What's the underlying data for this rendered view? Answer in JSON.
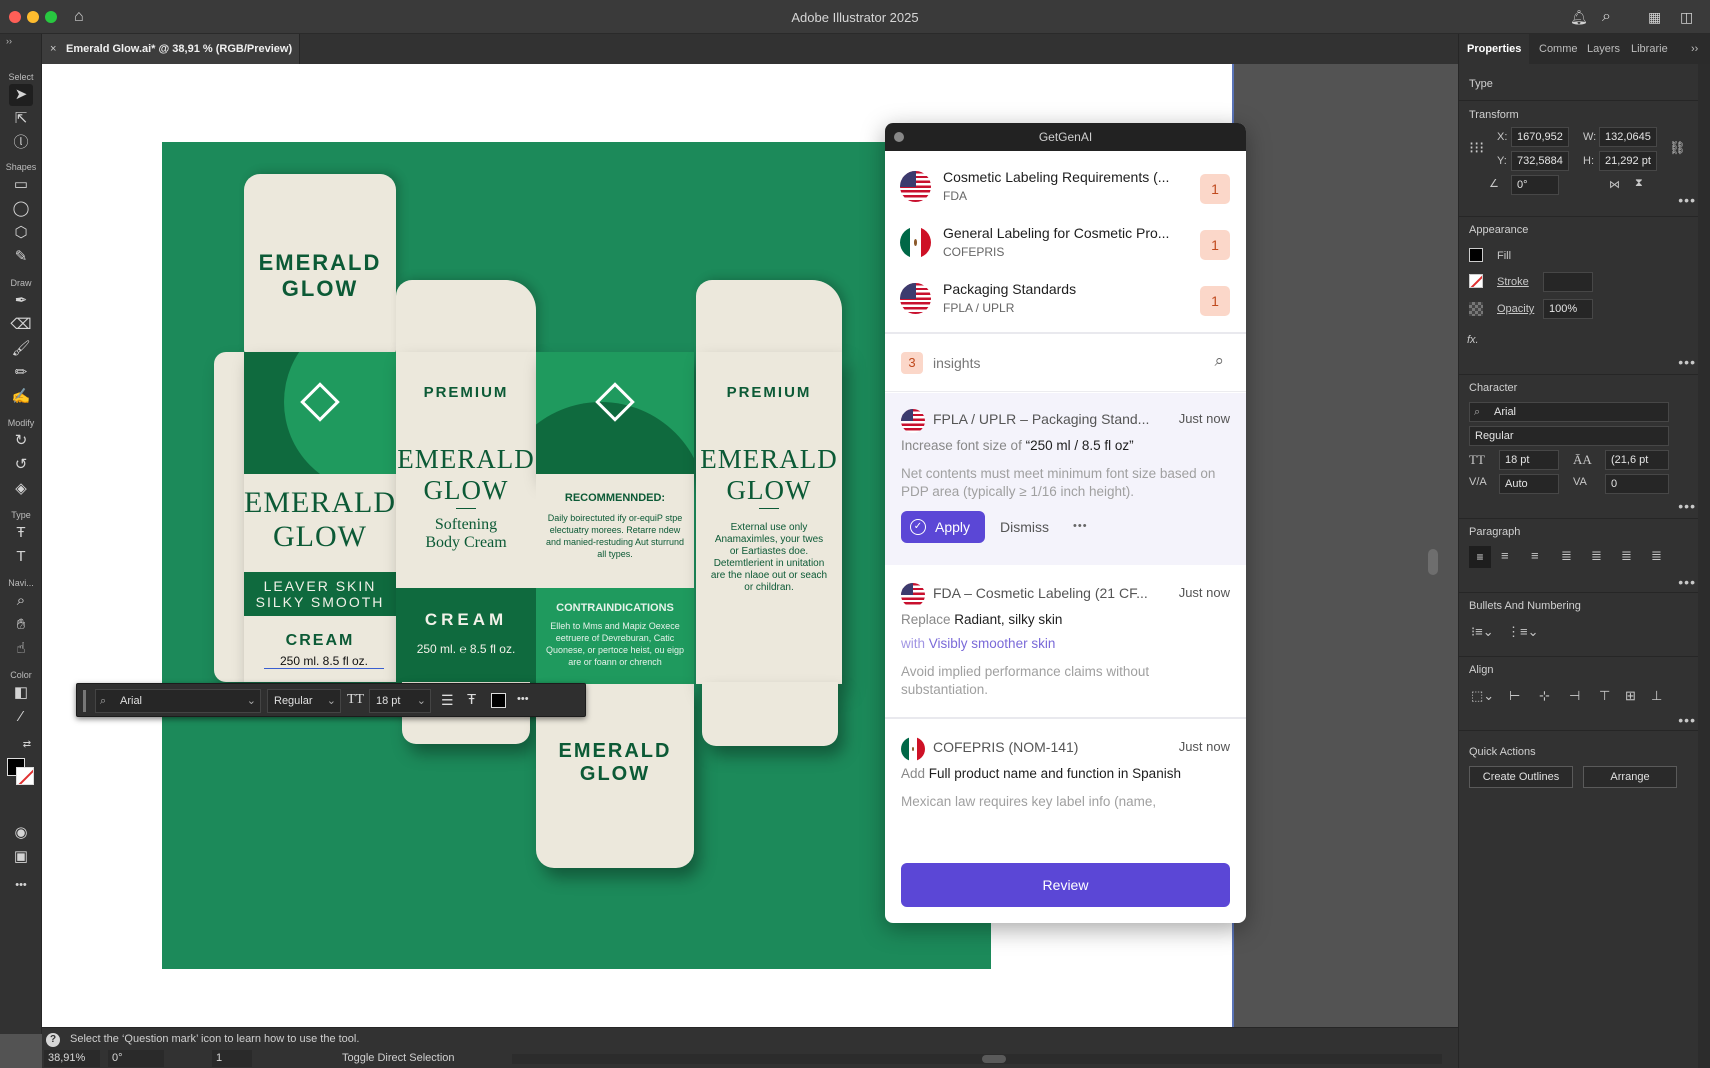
{
  "app": {
    "title": "Adobe Illustrator 2025",
    "traffic": {
      "close": "#ff5f57",
      "min": "#febc2e",
      "max": "#28c840"
    },
    "icons": {
      "home": "home-icon",
      "bell": "bell-icon",
      "search": "search-icon",
      "workspace": "workspace-icon",
      "panels": "panel-toggle-icon"
    }
  },
  "document": {
    "tab": "Emerald Glow.ai* @ 38,91 % (RGB/Preview)",
    "close": "×"
  },
  "toolbar": {
    "sections": [
      "Select",
      "Shapes",
      "Draw",
      "Modify",
      "Type",
      "Navi...",
      "Color"
    ],
    "more": "•••"
  },
  "artwork": {
    "background": "#1c8a5a",
    "left_box": {
      "brand": [
        "EMERALD",
        "GLOW"
      ],
      "front": [
        "EMERALD",
        "GLOW"
      ],
      "band": [
        "LEAVER SKIN",
        "SILKY SMOOTH"
      ],
      "product": "CREAM",
      "size": "250 ml. 8.5 fl oz."
    },
    "center_box": {
      "tag": "PREMIUM",
      "brand": [
        "EMERALD",
        "GLOW"
      ],
      "desc": [
        "Softening",
        "Body Cream"
      ],
      "product": "CREAM",
      "size": "250 ml. ℮ 8.5 fl oz."
    },
    "info_panel": {
      "rec_title": "RECOMMENNDED:",
      "rec_text": "Daily boirectuted ify or-equiP stpe electuatry morees. Retarre ndew and manied-restuding Aut sturrund all types.",
      "contra_title": "CONTRAINDICATIONS",
      "contra_text": "Elleh to Mms and Mapiz Oexece eetruere of Devreburan, Catic Quonese, or pertoce heist, ou eigp are or foann or chrench",
      "bottom_brand": [
        "EMERALD",
        "GLOW"
      ]
    },
    "right_box": {
      "tag": "PREMIUM",
      "brand": [
        "EMERALD",
        "GLOW"
      ],
      "text": "External use only Anamaximles, your twes or Eartiastes doe. Detemtlerient in unitation are the nlaoe out or seach or childran."
    }
  },
  "floating_bar": {
    "font": "Arial",
    "style": "Regular",
    "size": "18 pt",
    "more": "•••"
  },
  "getgenai": {
    "title": "GetGenAI",
    "regulations": [
      {
        "title": "Cosmetic Labeling Requirements (...",
        "sub": "FDA",
        "count": "1",
        "flag": "us"
      },
      {
        "title": "General Labeling for Cosmetic Pro...",
        "sub": "COFEPRIS",
        "count": "1",
        "flag": "mx"
      },
      {
        "title": "Packaging Standards",
        "sub": "FPLA / UPLR",
        "count": "1",
        "flag": "us"
      }
    ],
    "insights_count": "3",
    "insights_label": "insights",
    "cards": [
      {
        "source": "FPLA / UPLR – Packaging Stand...",
        "time": "Just now",
        "action": "Increase font size of",
        "target": "“250 ml / 8.5 fl oz”",
        "note": "Net contents must meet minimum font size based on PDP area (typically ≥ 1/16 inch height).",
        "apply": "Apply",
        "dismiss": "Dismiss",
        "more": "•••"
      },
      {
        "source": "FDA – Cosmetic Labeling (21 CF...",
        "time": "Just now",
        "action": "Replace",
        "target": "Radiant, silky skin",
        "with_label": "with",
        "with_value": "Visibly smoother skin",
        "note": "Avoid implied performance claims without substantiation."
      },
      {
        "source": "COFEPRIS (NOM-141)",
        "time": "Just now",
        "action": "Add",
        "target": "Full product name and function in Spanish",
        "note": "Mexican law requires key label info (name,"
      }
    ],
    "review": "Review",
    "colors": {
      "accent": "#5b47d6",
      "badge_bg": "#fbd7c9",
      "badge_fg": "#c04a1e"
    }
  },
  "properties": {
    "tabs": [
      "Properties",
      "Comme",
      "Layers",
      "Librarie"
    ],
    "type_label": "Type",
    "transform": {
      "label": "Transform",
      "x_label": "X:",
      "x": "1670,952",
      "y_label": "Y:",
      "y": "732,5884",
      "w_label": "W:",
      "w": "132,0645",
      "h_label": "H:",
      "h": "21,292 pt",
      "rotate": "0°"
    },
    "appearance": {
      "label": "Appearance",
      "fill": "Fill",
      "stroke": "Stroke",
      "opacity": "Opacity",
      "opacity_value": "100%",
      "fx": "fx."
    },
    "character": {
      "label": "Character",
      "font": "Arial",
      "style": "Regular",
      "size": "18 pt",
      "leading": "(21,6 pt",
      "kerning": "Auto",
      "tracking": "0"
    },
    "paragraph_label": "Paragraph",
    "bullets_label": "Bullets And Numbering",
    "align_label": "Align",
    "quick_actions": {
      "label": "Quick Actions",
      "outlines": "Create Outlines",
      "arrange": "Arrange"
    }
  },
  "status": {
    "tip": "Select the ‘Question mark’ icon to learn how to use the tool.",
    "zoom": "38,91%",
    "rotation": "0°",
    "page": "1",
    "mode": "Toggle Direct Selection"
  }
}
